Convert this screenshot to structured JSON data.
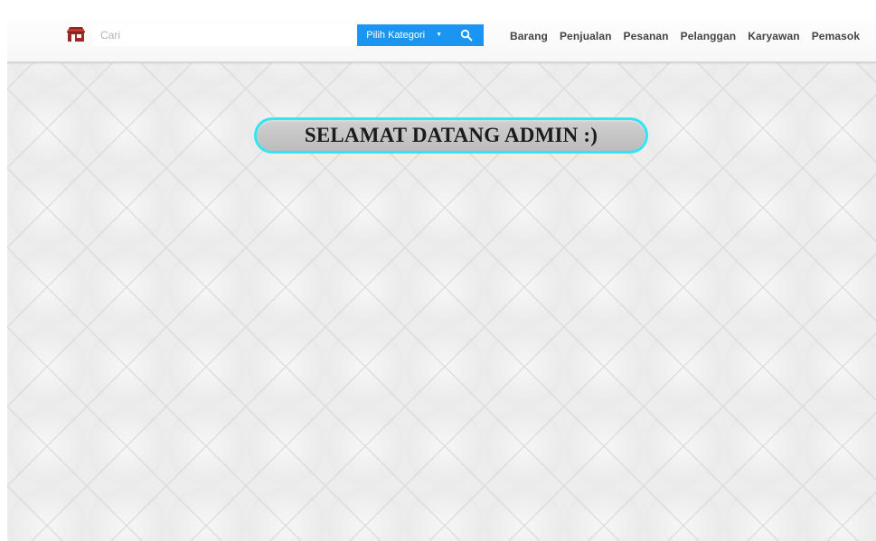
{
  "header": {
    "search": {
      "placeholder": "Cari",
      "category_label": "Pilih Kategori"
    },
    "nav": [
      {
        "label": "Barang"
      },
      {
        "label": "Penjualan"
      },
      {
        "label": "Pesanan"
      },
      {
        "label": "Pelanggan"
      },
      {
        "label": "Karyawan"
      },
      {
        "label": "Pemasok"
      }
    ],
    "colors": {
      "accent": "#1a96f2",
      "welcome_border": "#33e4f1",
      "welcome_fill": "#c8c8c8"
    }
  },
  "main": {
    "welcome_message": "SELAMAT DATANG ADMIN :)"
  },
  "icons": {
    "logo": "store-logo-icon",
    "dropdown": "caret-down-icon",
    "search": "search-icon"
  }
}
